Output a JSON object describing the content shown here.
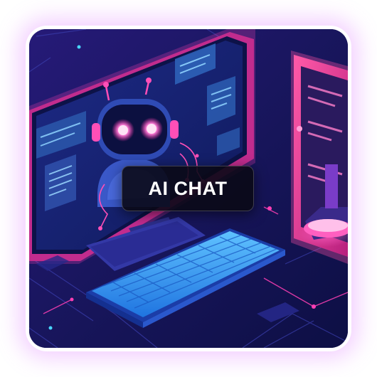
{
  "badge": {
    "label": "AI CHAT"
  },
  "icons": {
    "robot": "robot-icon",
    "monitor": "monitor-icon",
    "keyboard": "keyboard-icon",
    "tablet": "tablet-icon"
  },
  "colors": {
    "background": "#15124f",
    "neon_pink": "#ff3fb4",
    "neon_cyan": "#49d6ff",
    "keyboard_blue": "#3aa7ff",
    "badge_bg": "#0a0916",
    "badge_text": "#ffffff"
  }
}
